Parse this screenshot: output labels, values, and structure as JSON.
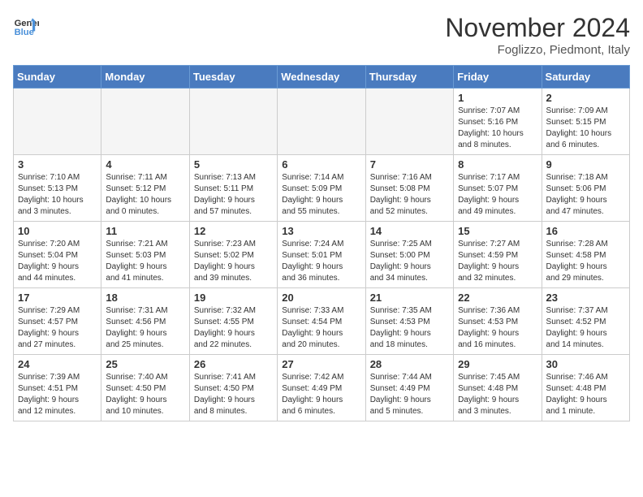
{
  "header": {
    "logo_line1": "General",
    "logo_line2": "Blue",
    "month": "November 2024",
    "location": "Foglizzo, Piedmont, Italy"
  },
  "weekdays": [
    "Sunday",
    "Monday",
    "Tuesday",
    "Wednesday",
    "Thursday",
    "Friday",
    "Saturday"
  ],
  "weeks": [
    [
      {
        "day": "",
        "text": ""
      },
      {
        "day": "",
        "text": ""
      },
      {
        "day": "",
        "text": ""
      },
      {
        "day": "",
        "text": ""
      },
      {
        "day": "",
        "text": ""
      },
      {
        "day": "1",
        "text": "Sunrise: 7:07 AM\nSunset: 5:16 PM\nDaylight: 10 hours\nand 8 minutes."
      },
      {
        "day": "2",
        "text": "Sunrise: 7:09 AM\nSunset: 5:15 PM\nDaylight: 10 hours\nand 6 minutes."
      }
    ],
    [
      {
        "day": "3",
        "text": "Sunrise: 7:10 AM\nSunset: 5:13 PM\nDaylight: 10 hours\nand 3 minutes."
      },
      {
        "day": "4",
        "text": "Sunrise: 7:11 AM\nSunset: 5:12 PM\nDaylight: 10 hours\nand 0 minutes."
      },
      {
        "day": "5",
        "text": "Sunrise: 7:13 AM\nSunset: 5:11 PM\nDaylight: 9 hours\nand 57 minutes."
      },
      {
        "day": "6",
        "text": "Sunrise: 7:14 AM\nSunset: 5:09 PM\nDaylight: 9 hours\nand 55 minutes."
      },
      {
        "day": "7",
        "text": "Sunrise: 7:16 AM\nSunset: 5:08 PM\nDaylight: 9 hours\nand 52 minutes."
      },
      {
        "day": "8",
        "text": "Sunrise: 7:17 AM\nSunset: 5:07 PM\nDaylight: 9 hours\nand 49 minutes."
      },
      {
        "day": "9",
        "text": "Sunrise: 7:18 AM\nSunset: 5:06 PM\nDaylight: 9 hours\nand 47 minutes."
      }
    ],
    [
      {
        "day": "10",
        "text": "Sunrise: 7:20 AM\nSunset: 5:04 PM\nDaylight: 9 hours\nand 44 minutes."
      },
      {
        "day": "11",
        "text": "Sunrise: 7:21 AM\nSunset: 5:03 PM\nDaylight: 9 hours\nand 41 minutes."
      },
      {
        "day": "12",
        "text": "Sunrise: 7:23 AM\nSunset: 5:02 PM\nDaylight: 9 hours\nand 39 minutes."
      },
      {
        "day": "13",
        "text": "Sunrise: 7:24 AM\nSunset: 5:01 PM\nDaylight: 9 hours\nand 36 minutes."
      },
      {
        "day": "14",
        "text": "Sunrise: 7:25 AM\nSunset: 5:00 PM\nDaylight: 9 hours\nand 34 minutes."
      },
      {
        "day": "15",
        "text": "Sunrise: 7:27 AM\nSunset: 4:59 PM\nDaylight: 9 hours\nand 32 minutes."
      },
      {
        "day": "16",
        "text": "Sunrise: 7:28 AM\nSunset: 4:58 PM\nDaylight: 9 hours\nand 29 minutes."
      }
    ],
    [
      {
        "day": "17",
        "text": "Sunrise: 7:29 AM\nSunset: 4:57 PM\nDaylight: 9 hours\nand 27 minutes."
      },
      {
        "day": "18",
        "text": "Sunrise: 7:31 AM\nSunset: 4:56 PM\nDaylight: 9 hours\nand 25 minutes."
      },
      {
        "day": "19",
        "text": "Sunrise: 7:32 AM\nSunset: 4:55 PM\nDaylight: 9 hours\nand 22 minutes."
      },
      {
        "day": "20",
        "text": "Sunrise: 7:33 AM\nSunset: 4:54 PM\nDaylight: 9 hours\nand 20 minutes."
      },
      {
        "day": "21",
        "text": "Sunrise: 7:35 AM\nSunset: 4:53 PM\nDaylight: 9 hours\nand 18 minutes."
      },
      {
        "day": "22",
        "text": "Sunrise: 7:36 AM\nSunset: 4:53 PM\nDaylight: 9 hours\nand 16 minutes."
      },
      {
        "day": "23",
        "text": "Sunrise: 7:37 AM\nSunset: 4:52 PM\nDaylight: 9 hours\nand 14 minutes."
      }
    ],
    [
      {
        "day": "24",
        "text": "Sunrise: 7:39 AM\nSunset: 4:51 PM\nDaylight: 9 hours\nand 12 minutes."
      },
      {
        "day": "25",
        "text": "Sunrise: 7:40 AM\nSunset: 4:50 PM\nDaylight: 9 hours\nand 10 minutes."
      },
      {
        "day": "26",
        "text": "Sunrise: 7:41 AM\nSunset: 4:50 PM\nDaylight: 9 hours\nand 8 minutes."
      },
      {
        "day": "27",
        "text": "Sunrise: 7:42 AM\nSunset: 4:49 PM\nDaylight: 9 hours\nand 6 minutes."
      },
      {
        "day": "28",
        "text": "Sunrise: 7:44 AM\nSunset: 4:49 PM\nDaylight: 9 hours\nand 5 minutes."
      },
      {
        "day": "29",
        "text": "Sunrise: 7:45 AM\nSunset: 4:48 PM\nDaylight: 9 hours\nand 3 minutes."
      },
      {
        "day": "30",
        "text": "Sunrise: 7:46 AM\nSunset: 4:48 PM\nDaylight: 9 hours\nand 1 minute."
      }
    ]
  ]
}
